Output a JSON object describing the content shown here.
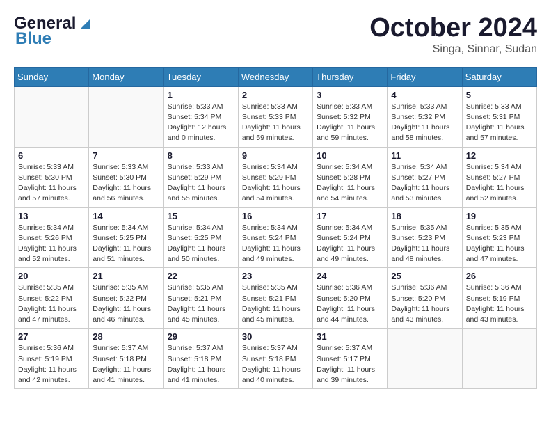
{
  "header": {
    "logo_general": "General",
    "logo_blue": "Blue",
    "month": "October 2024",
    "location": "Singa, Sinnar, Sudan"
  },
  "weekdays": [
    "Sunday",
    "Monday",
    "Tuesday",
    "Wednesday",
    "Thursday",
    "Friday",
    "Saturday"
  ],
  "weeks": [
    [
      {
        "day": "",
        "info": ""
      },
      {
        "day": "",
        "info": ""
      },
      {
        "day": "1",
        "info": "Sunrise: 5:33 AM\nSunset: 5:34 PM\nDaylight: 12 hours\nand 0 minutes."
      },
      {
        "day": "2",
        "info": "Sunrise: 5:33 AM\nSunset: 5:33 PM\nDaylight: 11 hours\nand 59 minutes."
      },
      {
        "day": "3",
        "info": "Sunrise: 5:33 AM\nSunset: 5:32 PM\nDaylight: 11 hours\nand 59 minutes."
      },
      {
        "day": "4",
        "info": "Sunrise: 5:33 AM\nSunset: 5:32 PM\nDaylight: 11 hours\nand 58 minutes."
      },
      {
        "day": "5",
        "info": "Sunrise: 5:33 AM\nSunset: 5:31 PM\nDaylight: 11 hours\nand 57 minutes."
      }
    ],
    [
      {
        "day": "6",
        "info": "Sunrise: 5:33 AM\nSunset: 5:30 PM\nDaylight: 11 hours\nand 57 minutes."
      },
      {
        "day": "7",
        "info": "Sunrise: 5:33 AM\nSunset: 5:30 PM\nDaylight: 11 hours\nand 56 minutes."
      },
      {
        "day": "8",
        "info": "Sunrise: 5:33 AM\nSunset: 5:29 PM\nDaylight: 11 hours\nand 55 minutes."
      },
      {
        "day": "9",
        "info": "Sunrise: 5:34 AM\nSunset: 5:29 PM\nDaylight: 11 hours\nand 54 minutes."
      },
      {
        "day": "10",
        "info": "Sunrise: 5:34 AM\nSunset: 5:28 PM\nDaylight: 11 hours\nand 54 minutes."
      },
      {
        "day": "11",
        "info": "Sunrise: 5:34 AM\nSunset: 5:27 PM\nDaylight: 11 hours\nand 53 minutes."
      },
      {
        "day": "12",
        "info": "Sunrise: 5:34 AM\nSunset: 5:27 PM\nDaylight: 11 hours\nand 52 minutes."
      }
    ],
    [
      {
        "day": "13",
        "info": "Sunrise: 5:34 AM\nSunset: 5:26 PM\nDaylight: 11 hours\nand 52 minutes."
      },
      {
        "day": "14",
        "info": "Sunrise: 5:34 AM\nSunset: 5:25 PM\nDaylight: 11 hours\nand 51 minutes."
      },
      {
        "day": "15",
        "info": "Sunrise: 5:34 AM\nSunset: 5:25 PM\nDaylight: 11 hours\nand 50 minutes."
      },
      {
        "day": "16",
        "info": "Sunrise: 5:34 AM\nSunset: 5:24 PM\nDaylight: 11 hours\nand 49 minutes."
      },
      {
        "day": "17",
        "info": "Sunrise: 5:34 AM\nSunset: 5:24 PM\nDaylight: 11 hours\nand 49 minutes."
      },
      {
        "day": "18",
        "info": "Sunrise: 5:35 AM\nSunset: 5:23 PM\nDaylight: 11 hours\nand 48 minutes."
      },
      {
        "day": "19",
        "info": "Sunrise: 5:35 AM\nSunset: 5:23 PM\nDaylight: 11 hours\nand 47 minutes."
      }
    ],
    [
      {
        "day": "20",
        "info": "Sunrise: 5:35 AM\nSunset: 5:22 PM\nDaylight: 11 hours\nand 47 minutes."
      },
      {
        "day": "21",
        "info": "Sunrise: 5:35 AM\nSunset: 5:22 PM\nDaylight: 11 hours\nand 46 minutes."
      },
      {
        "day": "22",
        "info": "Sunrise: 5:35 AM\nSunset: 5:21 PM\nDaylight: 11 hours\nand 45 minutes."
      },
      {
        "day": "23",
        "info": "Sunrise: 5:35 AM\nSunset: 5:21 PM\nDaylight: 11 hours\nand 45 minutes."
      },
      {
        "day": "24",
        "info": "Sunrise: 5:36 AM\nSunset: 5:20 PM\nDaylight: 11 hours\nand 44 minutes."
      },
      {
        "day": "25",
        "info": "Sunrise: 5:36 AM\nSunset: 5:20 PM\nDaylight: 11 hours\nand 43 minutes."
      },
      {
        "day": "26",
        "info": "Sunrise: 5:36 AM\nSunset: 5:19 PM\nDaylight: 11 hours\nand 43 minutes."
      }
    ],
    [
      {
        "day": "27",
        "info": "Sunrise: 5:36 AM\nSunset: 5:19 PM\nDaylight: 11 hours\nand 42 minutes."
      },
      {
        "day": "28",
        "info": "Sunrise: 5:37 AM\nSunset: 5:18 PM\nDaylight: 11 hours\nand 41 minutes."
      },
      {
        "day": "29",
        "info": "Sunrise: 5:37 AM\nSunset: 5:18 PM\nDaylight: 11 hours\nand 41 minutes."
      },
      {
        "day": "30",
        "info": "Sunrise: 5:37 AM\nSunset: 5:18 PM\nDaylight: 11 hours\nand 40 minutes."
      },
      {
        "day": "31",
        "info": "Sunrise: 5:37 AM\nSunset: 5:17 PM\nDaylight: 11 hours\nand 39 minutes."
      },
      {
        "day": "",
        "info": ""
      },
      {
        "day": "",
        "info": ""
      }
    ]
  ]
}
